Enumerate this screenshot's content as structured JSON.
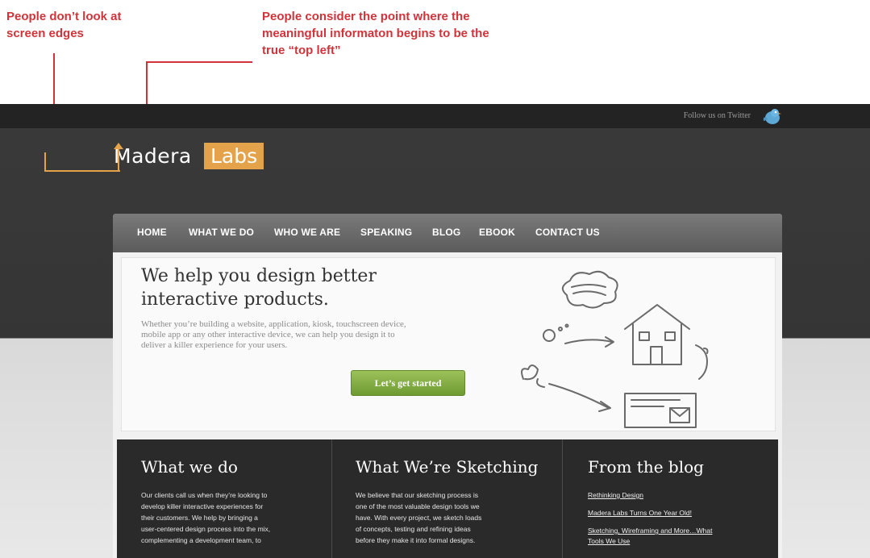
{
  "annotations": {
    "left_note_line1": "People don’t look at",
    "left_note_line2": "screen edges",
    "right_note_line1": "People consider the point where the",
    "right_note_line2": "meaningful informaton begins to be the",
    "right_note_line3": "true “top left”",
    "color": "#d0343a"
  },
  "topbar": {
    "twitter_text": "Follow us on Twitter",
    "twitter_icon": "twitter-bird-icon"
  },
  "logo": {
    "word1": "Madera",
    "word2": "Labs",
    "accent": "#e4a34a"
  },
  "nav": {
    "items": [
      "HOME",
      "WHAT WE DO",
      "WHO WE ARE",
      "SPEAKING",
      "BLOG",
      "EBOOK",
      "CONTACT US"
    ]
  },
  "hero": {
    "title_line1": "We help you design better",
    "title_line2": "interactive products.",
    "subtitle_line1": "Whether you’re building a website, application, kiosk, touchscreen device,",
    "subtitle_line2": "mobile app or any other interactive device, we can help you design it to",
    "subtitle_line3": "deliver a killer experience for your users.",
    "cta_label": "Let’s get started",
    "cta_color": "#7aa83a"
  },
  "columns": {
    "what_we_do": {
      "title": "What we do",
      "body_line1": "Our clients call us when they’re looking to",
      "body_line2": "develop killer interactive experiences for",
      "body_line3": "their customers. We help by bringing a",
      "body_line4": "user-centered design process into the mix,",
      "body_line5": "complementing a development team, to"
    },
    "sketching": {
      "title": "What We’re Sketching",
      "body_line1": "We believe that our sketching process is",
      "body_line2": "one of the most valuable design tools we",
      "body_line3": "have. With every project, we sketch loads",
      "body_line4": "of concepts, testing and refining ideas",
      "body_line5": "before they make it into formal designs."
    },
    "blog": {
      "title": "From the blog",
      "links": [
        "Rethinking Design",
        "Madera Labs Turns One Year Old!",
        "Sketching, Wireframing and More…What",
        "Tools We Use"
      ]
    }
  }
}
